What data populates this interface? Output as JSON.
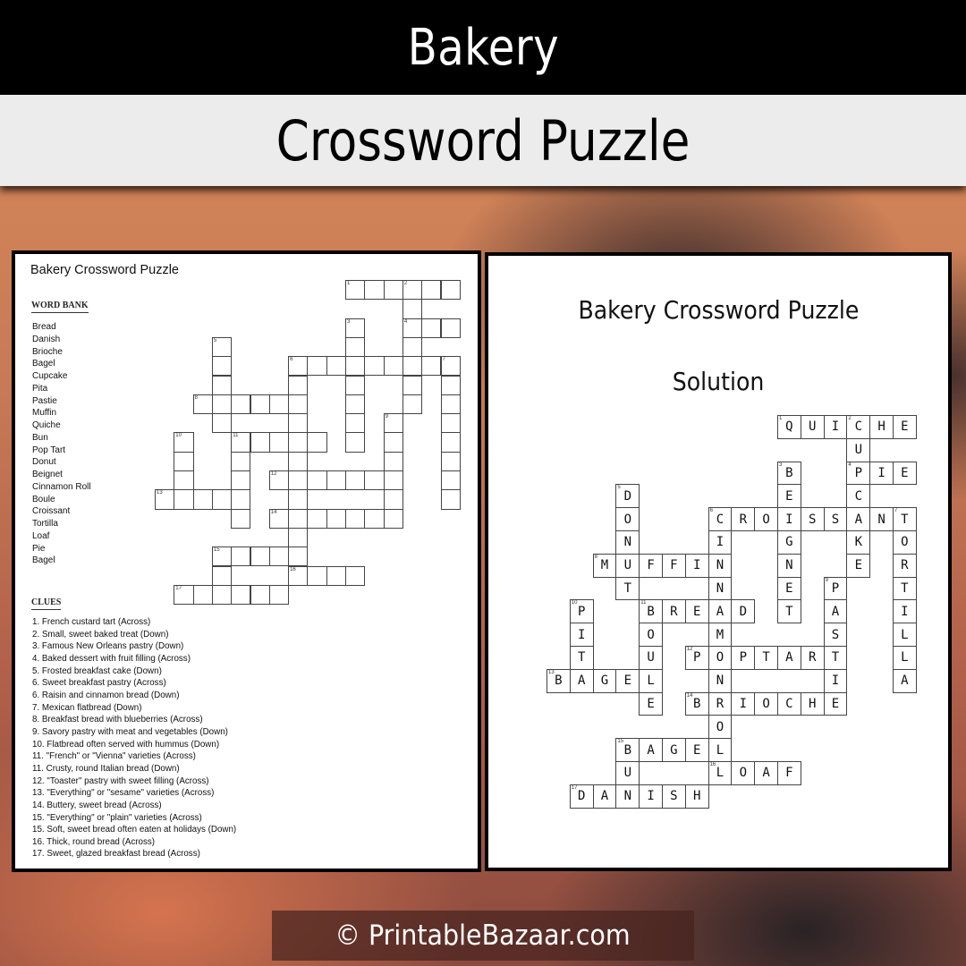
{
  "header": {
    "title": "Bakery",
    "subtitle": "Crossword Puzzle"
  },
  "puzzle_page": {
    "title": "Bakery Crossword Puzzle",
    "word_bank_heading": "WORD BANK",
    "word_bank": [
      "Bread",
      "Danish",
      "Brioche",
      "Bagel",
      "Cupcake",
      "Pita",
      "Pastie",
      "Muffin",
      "Quiche",
      "Bun",
      "Pop Tart",
      "Donut",
      "Beignet",
      "Cinnamon Roll",
      "Boule",
      "Croissant",
      "Tortilla",
      "Loaf",
      "Pie",
      "Bagel"
    ],
    "clues_heading": "CLUES",
    "clues": [
      "1. French custard tart (Across)",
      "2. Small, sweet baked treat (Down)",
      "3. Famous New Orleans pastry (Down)",
      "4. Baked dessert with fruit filling (Across)",
      "5. Frosted breakfast cake (Down)",
      "6. Sweet breakfast pastry (Across)",
      "6. Raisin and cinnamon bread (Down)",
      "7. Mexican flatbread (Down)",
      "8. Breakfast bread with blueberries (Across)",
      "9. Savory pastry with meat and vegetables (Down)",
      "10. Flatbread often served with hummus  (Down)",
      "11. \"French\" or \"Vienna\" varieties (Across)",
      "11. Crusty, round Italian bread (Down)",
      "12. \"Toaster\" pastry with sweet filling (Across)",
      "13. \"Everything\" or \"sesame\" varieties (Across)",
      "14. Buttery, sweet bread (Across)",
      "15. \"Everything\" or \"plain\" varieties (Across)",
      "15. Soft, sweet bread often eaten at holidays (Down)",
      "16. Thick, round bread (Across)",
      "17. Sweet, glazed breakfast bread (Across)"
    ]
  },
  "solution_page": {
    "title": "Bakery Crossword Puzzle",
    "subtitle": "Solution"
  },
  "crossword": {
    "entries": [
      {
        "num": 1,
        "dir": "across",
        "row": 0,
        "col": 10,
        "answer": "QUICHE"
      },
      {
        "num": 2,
        "dir": "down",
        "row": 0,
        "col": 13,
        "answer": "CUPCAKE"
      },
      {
        "num": 3,
        "dir": "down",
        "row": 2,
        "col": 10,
        "answer": "BEIGNET"
      },
      {
        "num": 4,
        "dir": "across",
        "row": 2,
        "col": 13,
        "answer": "PIE"
      },
      {
        "num": 5,
        "dir": "down",
        "row": 3,
        "col": 3,
        "answer": "DONUT"
      },
      {
        "num": 6,
        "dir": "across",
        "row": 4,
        "col": 7,
        "answer": "CROISSANT"
      },
      {
        "num": 6,
        "dir": "down",
        "row": 4,
        "col": 7,
        "answer": "CINNAMONROLL"
      },
      {
        "num": 7,
        "dir": "down",
        "row": 4,
        "col": 15,
        "answer": "TORTILLA"
      },
      {
        "num": 8,
        "dir": "across",
        "row": 6,
        "col": 2,
        "answer": "MUFFIN"
      },
      {
        "num": 9,
        "dir": "down",
        "row": 7,
        "col": 12,
        "answer": "PASTIE"
      },
      {
        "num": 10,
        "dir": "down",
        "row": 8,
        "col": 1,
        "answer": "PITA"
      },
      {
        "num": 11,
        "dir": "across",
        "row": 8,
        "col": 4,
        "answer": "BREAD"
      },
      {
        "num": 11,
        "dir": "down",
        "row": 8,
        "col": 4,
        "answer": "BOULE"
      },
      {
        "num": 12,
        "dir": "across",
        "row": 10,
        "col": 6,
        "answer": "POPTART"
      },
      {
        "num": 13,
        "dir": "across",
        "row": 11,
        "col": 0,
        "answer": "BAGEL"
      },
      {
        "num": 14,
        "dir": "across",
        "row": 12,
        "col": 6,
        "answer": "BRIOCHE"
      },
      {
        "num": 15,
        "dir": "across",
        "row": 14,
        "col": 3,
        "answer": "BAGEL"
      },
      {
        "num": 15,
        "dir": "down",
        "row": 14,
        "col": 3,
        "answer": "BUN"
      },
      {
        "num": 16,
        "dir": "across",
        "row": 15,
        "col": 7,
        "answer": "LOAF"
      },
      {
        "num": 17,
        "dir": "across",
        "row": 16,
        "col": 1,
        "answer": "DANISH"
      }
    ]
  },
  "footer": {
    "copyright": "© PrintableBazaar.com"
  }
}
